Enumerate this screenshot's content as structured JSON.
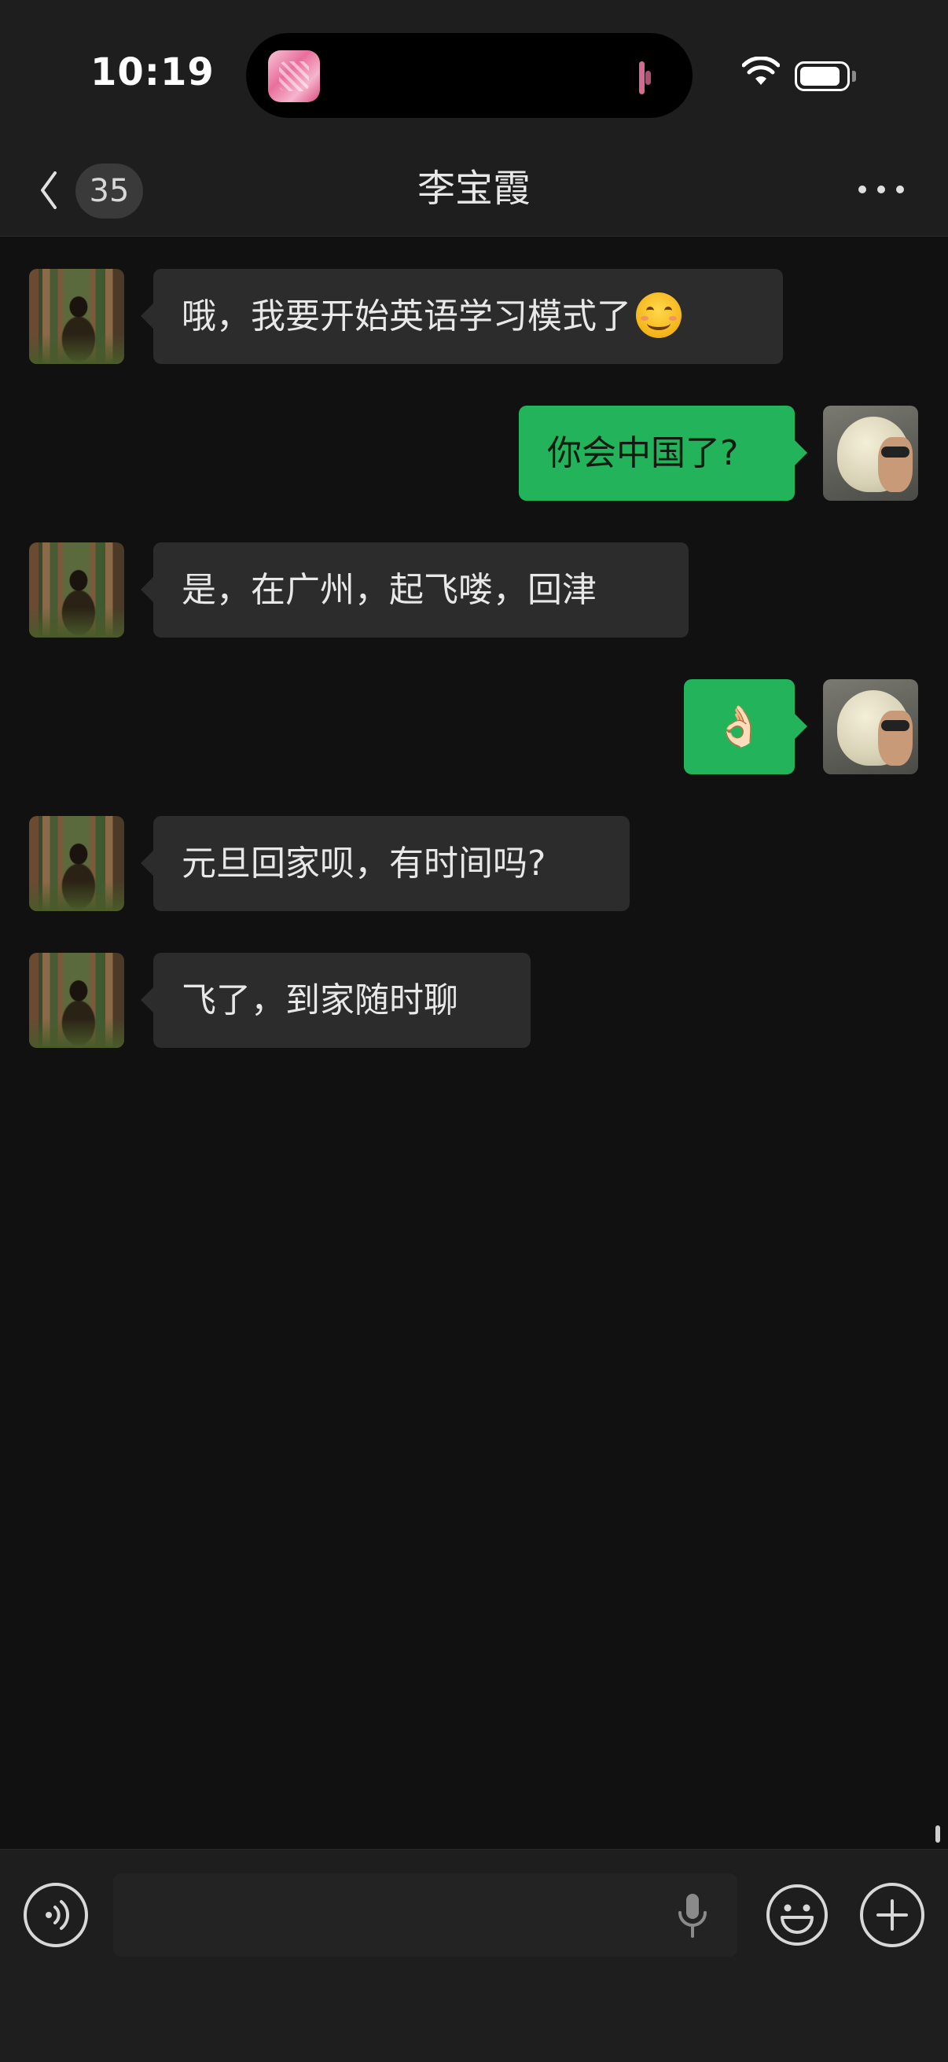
{
  "status_bar": {
    "time": "10:19"
  },
  "header": {
    "back_label": "35",
    "title": "李宝霞"
  },
  "messages": [
    {
      "sender": "other",
      "text": "哦，我要开始英语学习模式了",
      "emoji": "smiling-face-emoji"
    },
    {
      "sender": "me",
      "text": "你会中国了?"
    },
    {
      "sender": "other",
      "text": "是，在广州，起飞喽，回津"
    },
    {
      "sender": "me",
      "text": "👌🏻"
    },
    {
      "sender": "other",
      "text": "元旦回家呗，有时间吗?"
    },
    {
      "sender": "other",
      "text": "飞了，到家随时聊"
    }
  ],
  "input_bar": {
    "value": "",
    "placeholder": ""
  },
  "colors": {
    "outgoing_bubble": "#22b35b",
    "incoming_bubble": "#2c2c2c",
    "background": "#111111",
    "bars": "#1e1e1e"
  }
}
